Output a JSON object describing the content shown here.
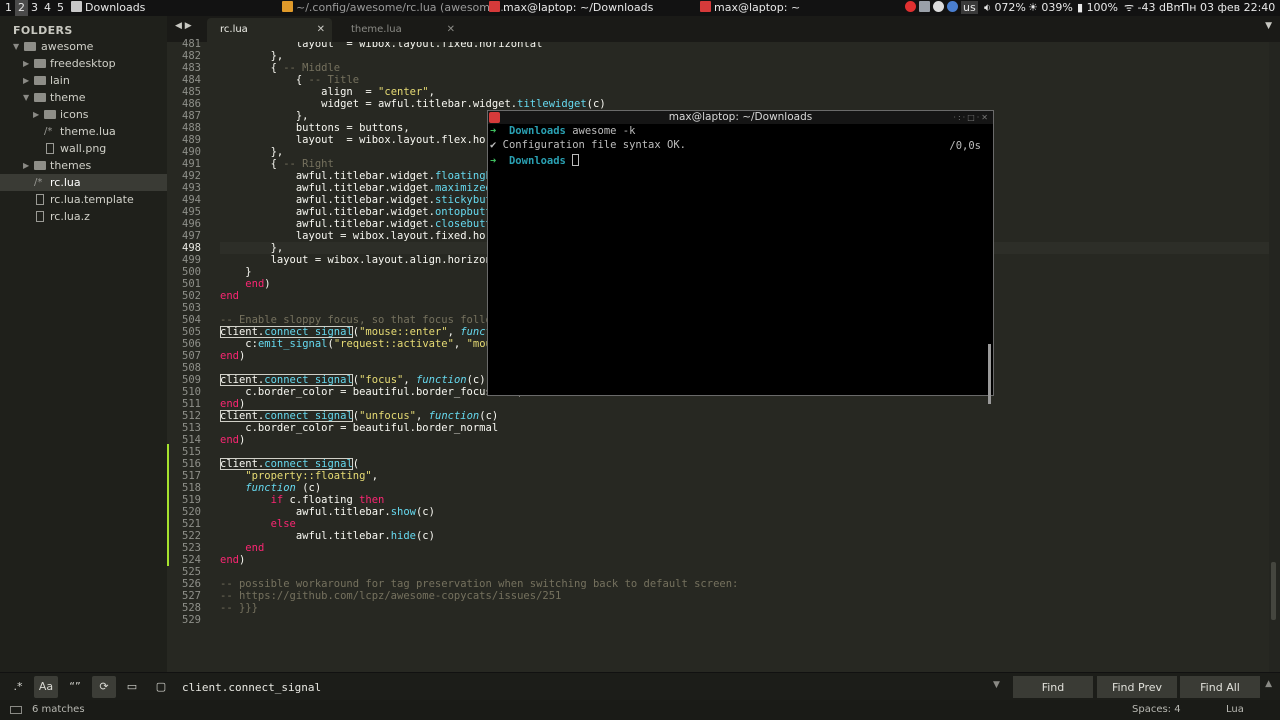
{
  "topbar": {
    "tags": [
      "1",
      "2",
      "3",
      "4",
      "5"
    ],
    "active_tag": "2",
    "current_dir": "Downloads",
    "tasks": [
      {
        "title": "~/.config/awesome/rc.lua (awesome..."
      },
      {
        "title": "max@laptop: ~/Downloads"
      },
      {
        "title": "max@laptop: ~"
      }
    ],
    "kbd_layout": "us",
    "volume": "072%",
    "brightness": "039%",
    "battery": "100%",
    "wifi": "-43 dBm",
    "clock": "Пн 03 фев 22:40"
  },
  "sidebar": {
    "header": "FOLDERS",
    "items": [
      {
        "label": "awesome"
      },
      {
        "label": "freedesktop"
      },
      {
        "label": "lain"
      },
      {
        "label": "theme"
      },
      {
        "label": "icons"
      },
      {
        "label": "theme.lua"
      },
      {
        "label": "wall.png"
      },
      {
        "label": "themes"
      },
      {
        "label": "rc.lua"
      },
      {
        "label": "rc.lua.template"
      },
      {
        "label": "rc.lua.z"
      }
    ]
  },
  "tabs": [
    {
      "label": "rc.lua"
    },
    {
      "label": "theme.lua"
    }
  ],
  "editor": {
    "line_numbers": [
      "481",
      "482",
      "483",
      "484",
      "485",
      "486",
      "487",
      "488",
      "489",
      "490",
      "491",
      "492",
      "493",
      "494",
      "495",
      "496",
      "497",
      "498",
      "499",
      "500",
      "501",
      "502",
      "503",
      "504",
      "505",
      "506",
      "507",
      "508",
      "509",
      "510",
      "511",
      "512",
      "513",
      "514",
      "515",
      "516",
      "517",
      "518",
      "519",
      "520",
      "521",
      "522",
      "523",
      "524",
      "525",
      "526",
      "527",
      "528",
      "529"
    ],
    "current_line": "498"
  },
  "terminal": {
    "title": "max@laptop: ~/Downloads",
    "prompt_dir": "Downloads",
    "command": "awesome -k",
    "output": "Configuration file syntax OK.",
    "elapsed": "/0,0s"
  },
  "findbar": {
    "query": "client.connect_signal",
    "opt_regex": ".*",
    "opt_case": "Aa",
    "opt_word": "“”",
    "find_label": "Find",
    "find_prev_label": "Find Prev",
    "find_all_label": "Find All"
  },
  "statusbar": {
    "matches": "6 matches",
    "indent": "Spaces: 4",
    "syntax": "Lua"
  },
  "colors": {
    "background": "#272822",
    "keyword": "#f92672",
    "function": "#66d9ef",
    "string": "#e6db74",
    "comment": "#75715e",
    "modified_marker": "#a6e22e"
  }
}
